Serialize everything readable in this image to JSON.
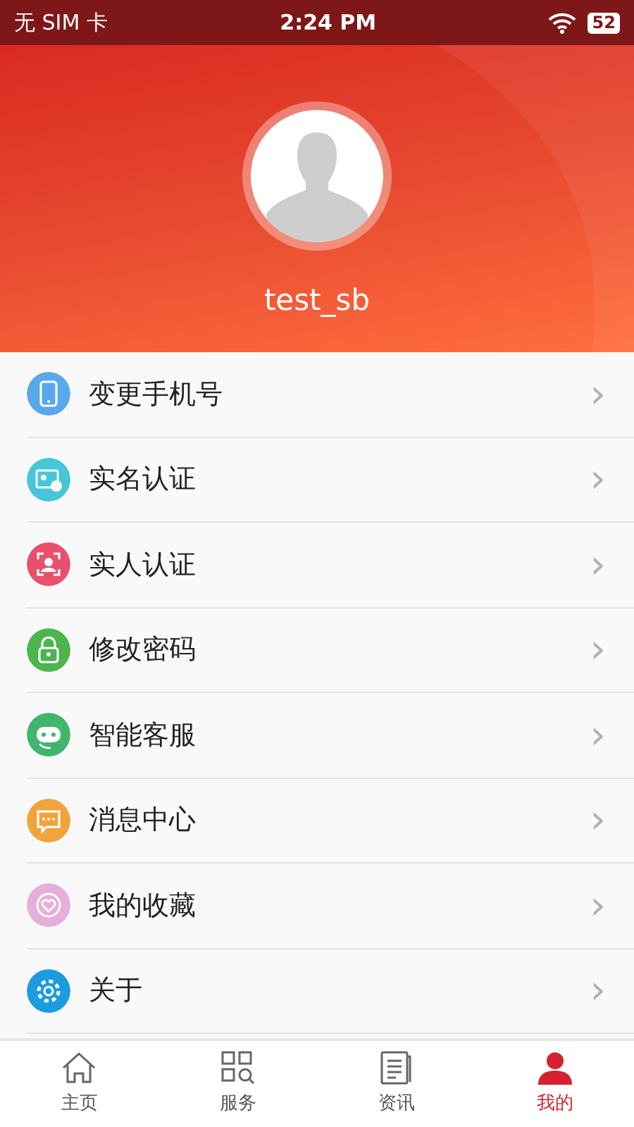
{
  "status_bar": {
    "carrier": "无 SIM 卡",
    "time": "2:24 PM",
    "battery": "52"
  },
  "profile": {
    "username": "test_sb"
  },
  "menu": [
    {
      "label": "变更手机号",
      "color": "#5aa8ec",
      "chevron": "›"
    },
    {
      "label": "实名认证",
      "color": "#45c6d9",
      "chevron": "›"
    },
    {
      "label": "实人认证",
      "color": "#e8506e",
      "chevron": "›"
    },
    {
      "label": "修改密码",
      "color": "#4bb54e",
      "chevron": "›"
    },
    {
      "label": "智能客服",
      "color": "#3fb56f",
      "chevron": "›"
    },
    {
      "label": "消息中心",
      "color": "#f0a43a",
      "chevron": "›"
    },
    {
      "label": "我的收藏",
      "color": "#e6aedb",
      "chevron": "›"
    },
    {
      "label": "关于",
      "color": "#1b9be0",
      "chevron": "›"
    }
  ],
  "tabs": [
    {
      "label": "主页",
      "selected": false
    },
    {
      "label": "服务",
      "selected": false
    },
    {
      "label": "资讯",
      "selected": false
    },
    {
      "label": "我的",
      "selected": true
    }
  ]
}
